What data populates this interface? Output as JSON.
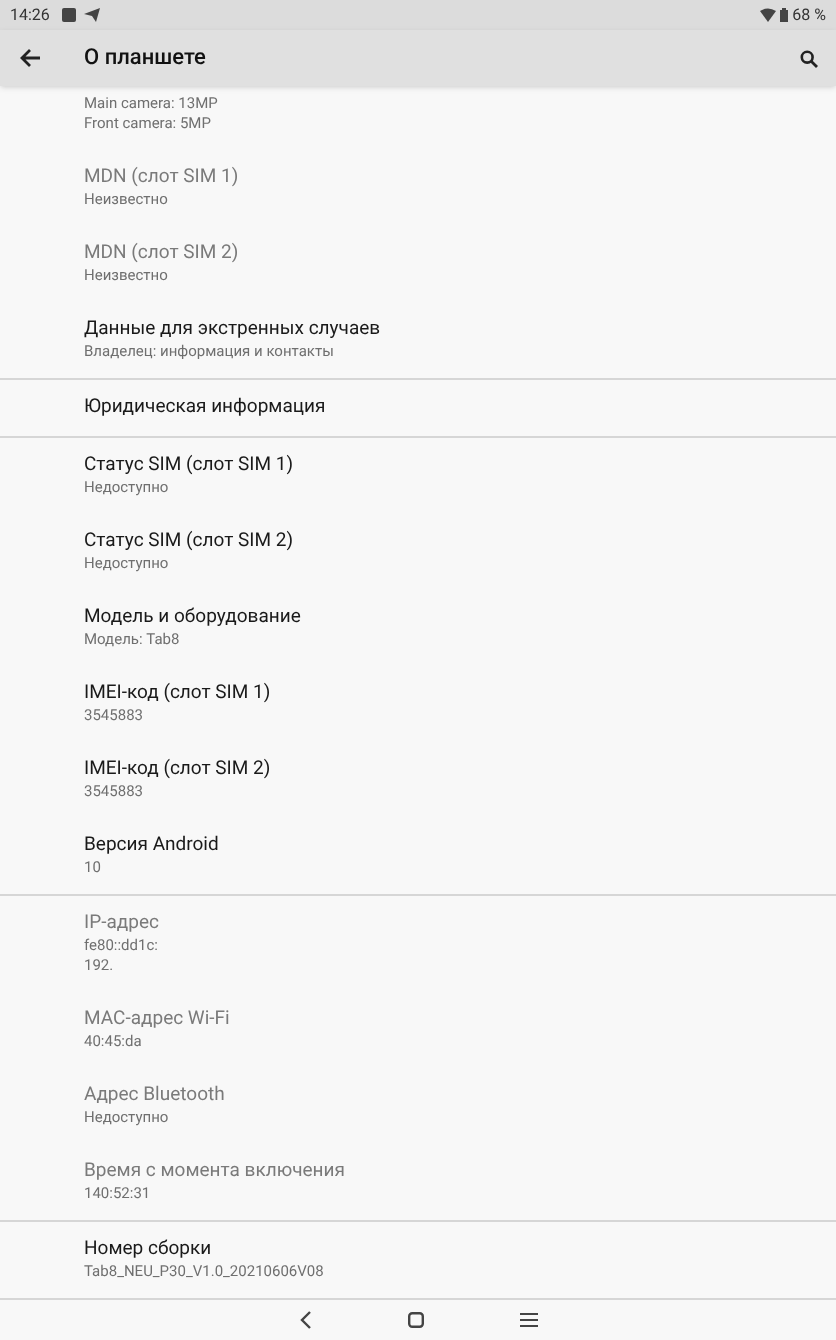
{
  "status_bar": {
    "time": "14:26",
    "battery": "68 %"
  },
  "app_bar": {
    "title": "О планшете"
  },
  "sections": [
    {
      "items": [
        {
          "lines": [
            "Main camera: 13MP",
            "Front camera: 5MP"
          ]
        },
        {
          "title": "MDN (слот SIM 1)",
          "disabled": true,
          "lines": [
            "Неизвестно"
          ]
        },
        {
          "title": "MDN (слот SIM 2)",
          "disabled": true,
          "lines": [
            "Неизвестно"
          ]
        },
        {
          "title": "Данные для экстренных случаев",
          "disabled": false,
          "lines": [
            "Владелец: информация и контакты"
          ]
        }
      ]
    },
    {
      "items": [
        {
          "title": "Юридическая информация",
          "disabled": false
        }
      ]
    },
    {
      "items": [
        {
          "title": "Статус SIM (слот SIM 1)",
          "disabled": false,
          "lines": [
            "Недоступно"
          ]
        },
        {
          "title": "Статус SIM (слот SIM 2)",
          "disabled": false,
          "lines": [
            "Недоступно"
          ]
        },
        {
          "title": "Модель и оборудование",
          "disabled": false,
          "lines": [
            "Модель: Tab8"
          ]
        },
        {
          "title": "IMEI-код (слот SIM 1)",
          "disabled": false,
          "lines": [
            "3545883"
          ]
        },
        {
          "title": "IMEI-код (слот SIM 2)",
          "disabled": false,
          "lines": [
            "3545883"
          ]
        },
        {
          "title": "Версия Android",
          "disabled": false,
          "lines": [
            "10"
          ]
        }
      ]
    },
    {
      "items": [
        {
          "title": "IP-адрес",
          "disabled": true,
          "lines": [
            "fe80::dd1c:",
            "192."
          ]
        },
        {
          "title": "MAC-адрес Wi-Fi",
          "disabled": true,
          "lines": [
            "40:45:da"
          ]
        },
        {
          "title": "Адрес Bluetooth",
          "disabled": true,
          "lines": [
            "Недоступно"
          ]
        },
        {
          "title": "Время с момента включения",
          "disabled": true,
          "lines": [
            "140:52:31"
          ]
        }
      ]
    },
    {
      "items": [
        {
          "title": "Номер сборки",
          "disabled": false,
          "lines": [
            "Tab8_NEU_P30_V1.0_20210606V08"
          ]
        }
      ]
    }
  ]
}
